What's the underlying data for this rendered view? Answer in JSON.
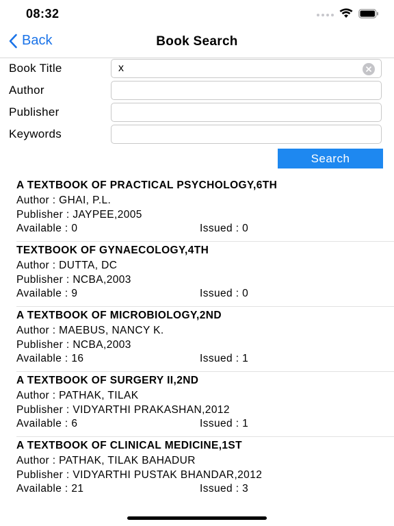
{
  "status_bar": {
    "time": "08:32"
  },
  "nav": {
    "back_label": "Back",
    "title": "Book Search"
  },
  "form": {
    "book_title_label": "Book Title",
    "book_title_value": "x",
    "author_label": "Author",
    "author_value": "",
    "publisher_label": "Publisher",
    "publisher_value": "",
    "keywords_label": "Keywords",
    "keywords_value": "",
    "search_label": "Search"
  },
  "results": [
    {
      "title": "A TEXTBOOK OF PRACTICAL PSYCHOLOGY,6TH",
      "author": "Author : GHAI, P.L.",
      "publisher": "Publisher : JAYPEE,2005",
      "available": "Available : 0",
      "issued": "Issued : 0"
    },
    {
      "title": "TEXTBOOK OF GYNAECOLOGY,4TH",
      "author": "Author : DUTTA, DC",
      "publisher": "Publisher : NCBA,2003",
      "available": "Available : 9",
      "issued": "Issued : 0"
    },
    {
      "title": "A TEXTBOOK OF MICROBIOLOGY,2ND",
      "author": "Author : MAEBUS, NANCY K.",
      "publisher": "Publisher : NCBA,2003",
      "available": "Available : 16",
      "issued": "Issued : 1"
    },
    {
      "title": "A TEXTBOOK OF SURGERY II,2ND",
      "author": "Author : PATHAK, TILAK",
      "publisher": "Publisher : VIDYARTHI PRAKASHAN,2012",
      "available": "Available : 6",
      "issued": "Issued : 1"
    },
    {
      "title": "A TEXTBOOK OF CLINICAL MEDICINE,1ST",
      "author": "Author : PATHAK, TILAK BAHADUR",
      "publisher": "Publisher : VIDYARTHI PUSTAK BHANDAR,2012",
      "available": "Available : 21",
      "issued": "Issued : 3"
    }
  ],
  "colors": {
    "accent": "#1e88f0",
    "link": "#1a73e8"
  },
  "icons": [
    "signal-icon",
    "wifi-icon",
    "battery-icon",
    "chevron-left-icon",
    "clear-icon"
  ]
}
